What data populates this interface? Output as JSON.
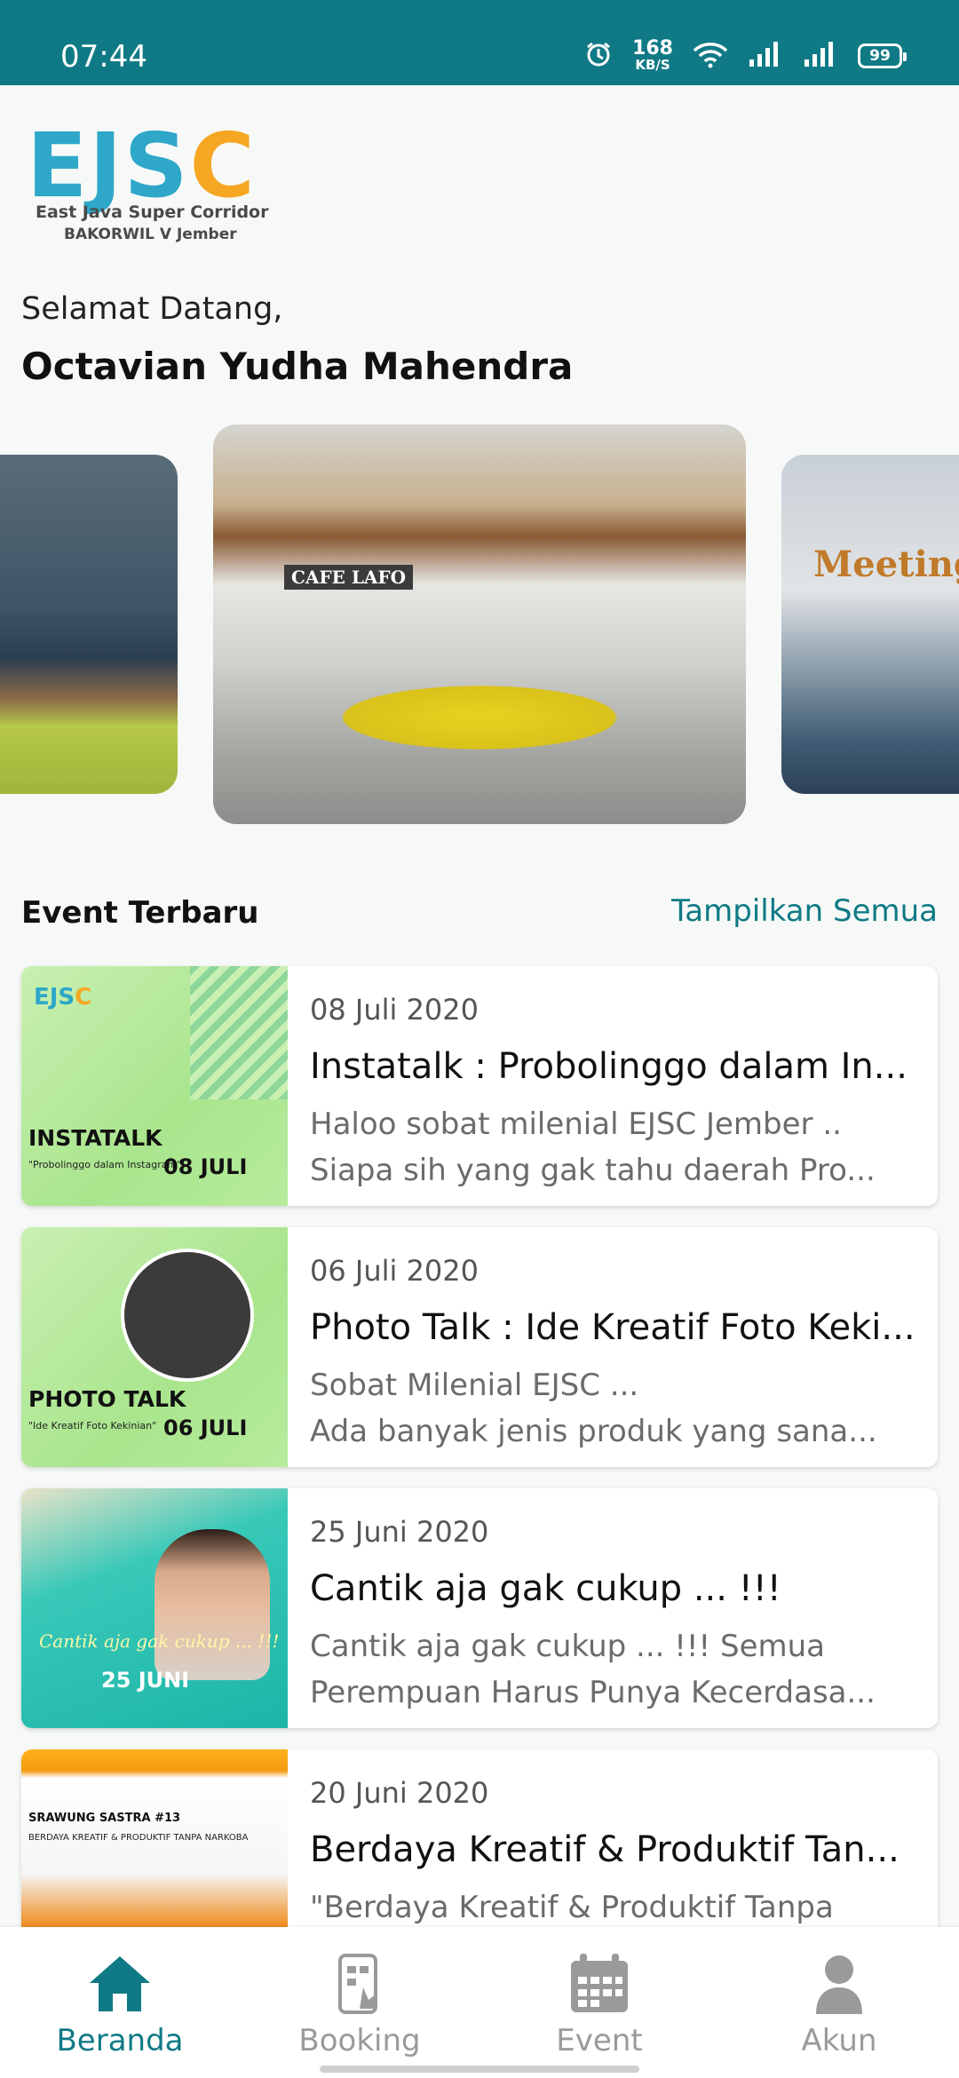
{
  "status_bar": {
    "time": "07:44",
    "net_speed_value": "168",
    "net_speed_unit": "KB/S",
    "battery": "99",
    "icons": [
      "alarm-icon",
      "wifi-icon",
      "signal-icon",
      "signal-icon",
      "battery-icon"
    ]
  },
  "header": {
    "logo_main_ejs": "EJS",
    "logo_main_c": "C",
    "logo_sub1": "East Java Super Corridor",
    "logo_sub2": "BAKORWIL V Jember"
  },
  "greeting": {
    "welcome": "Selamat Datang,",
    "user_name": "Octavian Yudha Mahendra"
  },
  "carousel": {
    "cafe_sign": "CAFE LAFO",
    "meeting_sign": "Meeting"
  },
  "events_section": {
    "title": "Event Terbaru",
    "see_all": "Tampilkan Semua",
    "events": [
      {
        "date": "08 Juli 2020",
        "title": "Instatalk : Probolinggo dalam In...",
        "desc1": "Haloo sobat milenial EJSC Jember ..",
        "desc2": "Siapa sih yang gak tahu daerah Pro...",
        "thumb_big": "INSTATALK",
        "thumb_small": "\"Probolinggo dalam Instagram\"",
        "thumb_date": "08 JULI"
      },
      {
        "date": "06 Juli 2020",
        "title": "Photo Talk : Ide Kreatif Foto Keki...",
        "desc1": "Sobat Milenial EJSC ...",
        "desc2": "Ada banyak jenis produk yang sana...",
        "thumb_big": "PHOTO TALK",
        "thumb_small": "\"Ide Kreatif Foto Kekinian\"",
        "thumb_date": "06 JULI"
      },
      {
        "date": "25 Juni 2020",
        "title": "Cantik aja gak cukup ... !!!",
        "desc1": "Cantik aja gak cukup ... !!! Semua",
        "desc2": "Perempuan Harus Punya Kecerdasa...",
        "thumb_script": "Cantik aja gak cukup ... !!!",
        "thumb_date": "25 JUNI"
      },
      {
        "date": "20 Juni 2020",
        "title": "Berdaya Kreatif & Produktif Tan...",
        "desc1": "\"Berdaya Kreatif & Produktif Tanpa",
        "desc2": "",
        "thumb_big": "SRAWUNG SASTRA #13",
        "thumb_small": "BERDAYA KREATIF & PRODUKTIF TANPA NARKOBA"
      }
    ]
  },
  "bottom_nav": {
    "items": [
      {
        "label": "Beranda",
        "icon": "home-icon",
        "active": true
      },
      {
        "label": "Booking",
        "icon": "booking-icon",
        "active": false
      },
      {
        "label": "Event",
        "icon": "calendar-icon",
        "active": false
      },
      {
        "label": "Akun",
        "icon": "account-icon",
        "active": false
      }
    ]
  },
  "colors": {
    "primary": "#0f7a85",
    "logo_blue": "#2ea7c9",
    "logo_orange": "#f5a623",
    "inactive": "#9a9a9a"
  }
}
